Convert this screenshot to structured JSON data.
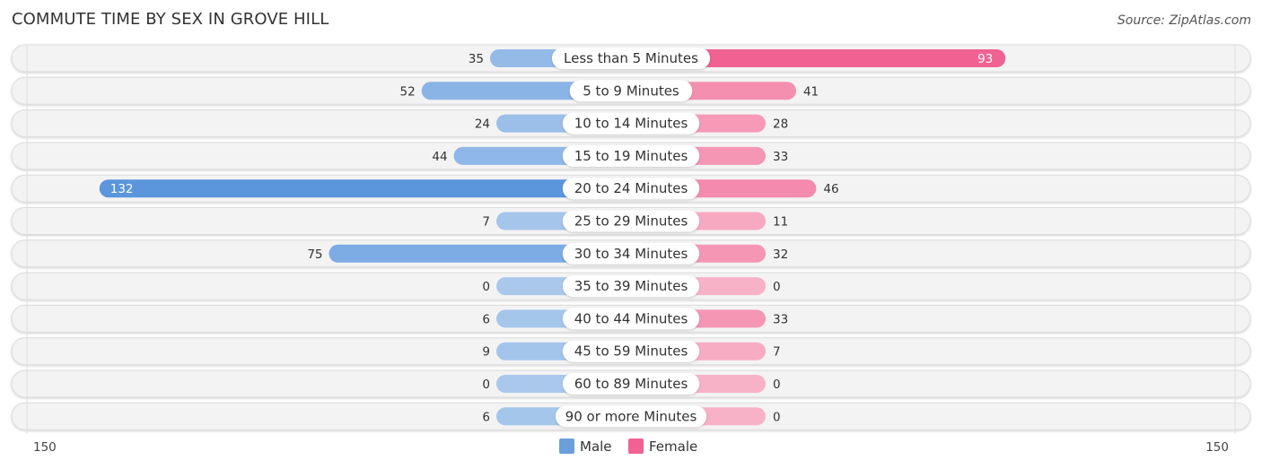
{
  "header": {
    "title": "COMMUTE TIME BY SEX IN GROVE HILL",
    "source": "Source: ZipAtlas.com"
  },
  "chart_data": {
    "type": "bar",
    "orientation": "horizontal-diverging",
    "title": "COMMUTE TIME BY SEX IN GROVE HILL",
    "categories": [
      "Less than 5 Minutes",
      "5 to 9 Minutes",
      "10 to 14 Minutes",
      "15 to 19 Minutes",
      "20 to 24 Minutes",
      "25 to 29 Minutes",
      "30 to 34 Minutes",
      "35 to 39 Minutes",
      "40 to 44 Minutes",
      "45 to 59 Minutes",
      "60 to 89 Minutes",
      "90 or more Minutes"
    ],
    "series": [
      {
        "name": "Male",
        "color": "#6a9fdc",
        "values": [
          35,
          52,
          24,
          44,
          132,
          7,
          75,
          0,
          6,
          9,
          0,
          6
        ]
      },
      {
        "name": "Female",
        "color": "#f06292",
        "values": [
          93,
          41,
          28,
          33,
          46,
          11,
          32,
          0,
          33,
          7,
          0,
          0
        ]
      }
    ],
    "axis": {
      "left_label": "150",
      "right_label": "150",
      "max": 150
    },
    "legend": {
      "placement": "bottom-center",
      "entries": [
        "Male",
        "Female"
      ]
    }
  }
}
